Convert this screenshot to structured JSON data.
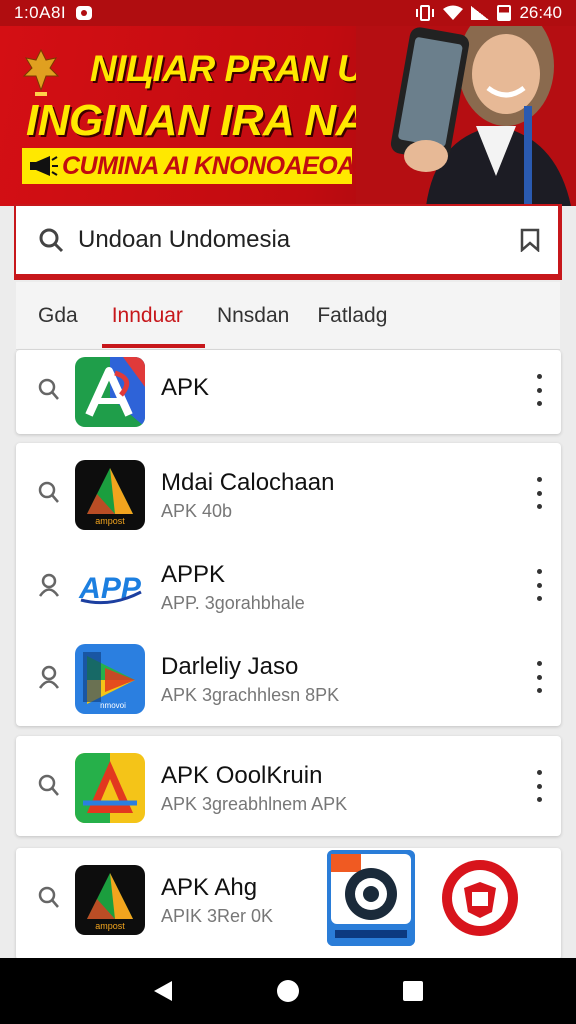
{
  "status_bar": {
    "time": "1:0A8I",
    "right_text": "26:40"
  },
  "banner": {
    "line1": "NIЦIAR PRAN UNDAIAN",
    "line2": "INGINAN IRA NAI!'",
    "sub": "CUMINA AI KNONOAEOASIA!"
  },
  "search": {
    "query": "Undoan Undomesia"
  },
  "tabs": [
    {
      "label": "Gda",
      "active": false
    },
    {
      "label": "Innduar",
      "active": true
    },
    {
      "label": "Nnsdan",
      "active": false
    },
    {
      "label": "Fatladg",
      "active": false
    }
  ],
  "results": [
    {
      "title": "APK",
      "subtitle": ""
    },
    {
      "title": "Mdai Calochaan",
      "subtitle": "APK 40b"
    },
    {
      "title": "APPK",
      "subtitle": "APP. 3gorahbhale"
    },
    {
      "title": "Darleliy Jaso",
      "subtitle": "APK 3grachhlesn 8PK"
    },
    {
      "title": "APK OoolKruin",
      "subtitle": "APK 3greabhlnem APK"
    },
    {
      "title": "APK   Ahg",
      "subtitle": "APIK 3Rer 0K"
    }
  ],
  "icon_labels": {
    "ampost": "ampost",
    "nmovoi": "nmovoi",
    "app_logo": "APP"
  },
  "colors": {
    "accent": "#c7171b",
    "banner_yellow": "#ffe800"
  }
}
